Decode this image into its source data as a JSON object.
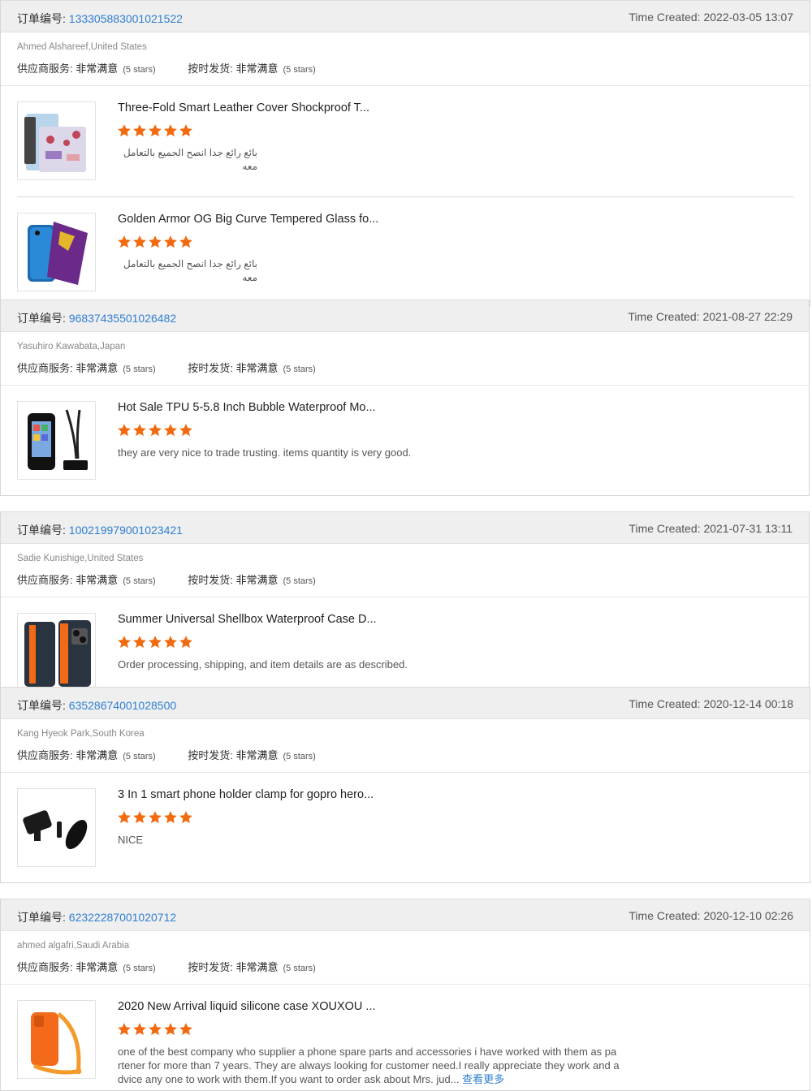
{
  "orders": [
    {
      "label": "订单编号:",
      "number": "1333058830010215​22",
      "time": "Time Created: 2022-03-05 13:07",
      "buyer": "Ahmed Alshareef,United States",
      "supplier_label": "供应商服务:",
      "supplier_value": "非常满意",
      "supplier_stars": "(5 stars)",
      "shipping_label": "按时发货:",
      "shipping_value": "非常满意",
      "shipping_stars": "(5 stars)",
      "items": [
        {
          "title": "Three-Fold Smart Leather Cover Shockproof T...",
          "stars": 5,
          "review": "بائع رائع جدا انصح الجميع بالتعامل معه",
          "thumb": "tablet-case"
        },
        {
          "title": "Golden Armor OG Big Curve Tempered Glass fo...",
          "stars": 5,
          "review": "بائع رائع جدا انصح الجميع بالتعامل معه",
          "thumb": "phone-glass"
        }
      ]
    },
    {
      "label": "订单编号:",
      "number": "968374355010264​82",
      "time": "Time Created: 2021-08-27 22:29",
      "buyer": "Yasuhiro Kawabata,Japan",
      "supplier_label": "供应商服务:",
      "supplier_value": "非常满意",
      "supplier_stars": "(5 stars)",
      "shipping_label": "按时发货:",
      "shipping_value": "非常满意",
      "shipping_stars": "(5 stars)",
      "items": [
        {
          "title": "Hot Sale TPU 5-5.8 Inch Bubble Waterproof Mo...",
          "stars": 5,
          "review": "they are very nice to trade trusting. items quantity is very good.",
          "thumb": "waterproof-bag"
        }
      ]
    },
    {
      "label": "订单编号:",
      "number": "100219979001023421",
      "time": "Time Created: 2021-07-31 13:11",
      "buyer": "Sadie Kunishige,United States",
      "supplier_label": "供应商服务:",
      "supplier_value": "非常满意",
      "supplier_stars": "(5 stars)",
      "shipping_label": "按时发货:",
      "shipping_value": "非常满意",
      "shipping_stars": "(5 stars)",
      "items": [
        {
          "title": "Summer Universal Shellbox Waterproof Case D...",
          "stars": 5,
          "review": "Order processing, shipping, and item details are as described.",
          "thumb": "shellbox"
        }
      ]
    },
    {
      "label": "订单编号:",
      "number": "63528674001028500",
      "time": "Time Created: 2020-12-14 00:18",
      "buyer": "Kang Hyeok Park,South Korea",
      "supplier_label": "供应商服务:",
      "supplier_value": "非常满意",
      "supplier_stars": "(5 stars)",
      "shipping_label": "按时发货:",
      "shipping_value": "非常满意",
      "shipping_stars": "(5 stars)",
      "items": [
        {
          "title": "3 In 1 smart phone holder clamp for gopro hero...",
          "stars": 5,
          "review": "NICE",
          "thumb": "clamp"
        }
      ]
    },
    {
      "label": "订单编号:",
      "number": "62322287001020712",
      "time": "Time Created: 2020-12-10 02:26",
      "buyer": "ahmed algafri,Saudi Arabia",
      "supplier_label": "供应商服务:",
      "supplier_value": "非常满意",
      "supplier_stars": "(5 stars)",
      "shipping_label": "按时发货:",
      "shipping_value": "非常满意",
      "shipping_stars": "(5 stars)",
      "items": [
        {
          "title": "2020 New Arrival liquid silicone case XOUXOU ...",
          "stars": 5,
          "review": "one of the best company who supplier a phone spare parts and accessories i have worked with them as pa rtener for more than 7 years. They are always looking for customer need.I really appreciate they work and a dvice any one to work with them.If you want to order ask about Mrs. jud...",
          "more": "查看更多",
          "thumb": "silicone-case"
        }
      ]
    }
  ],
  "colors": {
    "link": "#2f7fd2",
    "star": "#f26a10",
    "header_bg": "#efefef"
  }
}
